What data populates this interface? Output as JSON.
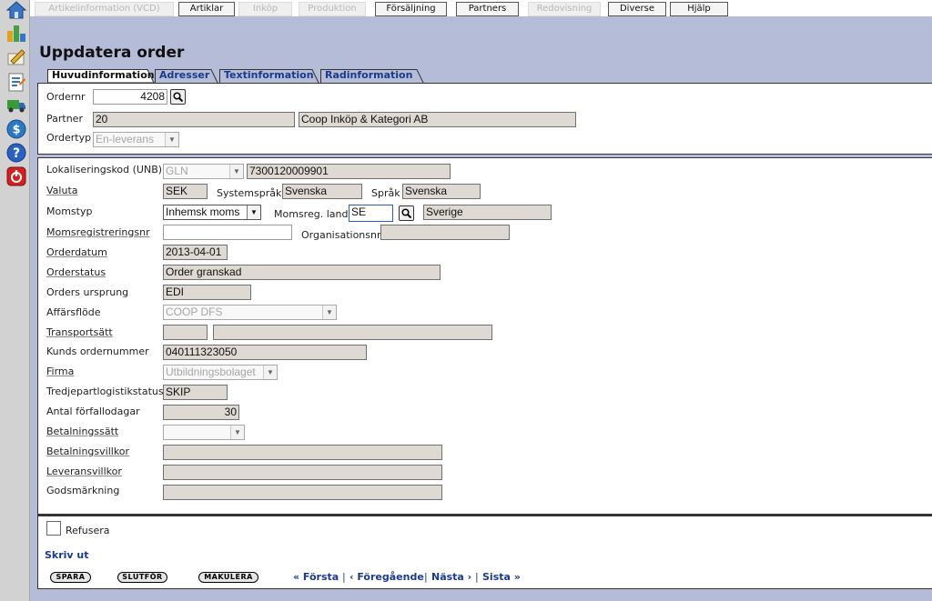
{
  "topmenu": {
    "items": [
      {
        "label": "Artikelinformation (VCD)",
        "enabled": false
      },
      {
        "label": "Artiklar",
        "enabled": true
      },
      {
        "label": "Inköp",
        "enabled": false
      },
      {
        "label": "Produktion",
        "enabled": false
      },
      {
        "label": "Försäljning",
        "enabled": true
      },
      {
        "label": "Partners",
        "enabled": true
      },
      {
        "label": "Redovisning",
        "enabled": false
      },
      {
        "label": "Diverse",
        "enabled": true
      },
      {
        "label": "Hjälp",
        "enabled": true
      }
    ]
  },
  "sidebar": {
    "icons": [
      "home-icon",
      "stats-icon",
      "edit-icon",
      "list-icon",
      "truck-icon",
      "money-icon",
      "help-icon",
      "power-icon"
    ]
  },
  "page": {
    "title": "Uppdatera order"
  },
  "tabs": [
    {
      "label": "Huvudinformation",
      "active": true
    },
    {
      "label": "Adresser",
      "active": false
    },
    {
      "label": "Textinformation",
      "active": false
    },
    {
      "label": "Radinformation",
      "active": false
    }
  ],
  "header": {
    "ordernr_label": "Ordernr",
    "ordernr_value": "4208",
    "partner_label": "Partner",
    "partner_code": "20",
    "partner_name": "Coop Inköp & Kategori AB",
    "ordertyp_label": "Ordertyp",
    "ordertyp_value": "En-leverans"
  },
  "details": {
    "lokaliseringskod_label": "Lokaliseringskod (UNB)",
    "lokaliseringskod_type": "GLN",
    "lokaliseringskod_value": "7300120009901",
    "valuta_label": "Valuta",
    "valuta_value": "SEK",
    "systemsprak_label": "Systemspråk",
    "systemsprak_value": "Svenska",
    "sprak_label": "Språk",
    "sprak_value": "Svenska",
    "momstyp_label": "Momstyp",
    "momstyp_value": "Inhemsk moms",
    "momsreg_land_label": "Momsreg. land",
    "momsreg_land_code": "SE",
    "momsreg_land_name": "Sverige",
    "momsregistreringsnr_label": "Momsregistreringsnr",
    "momsregistreringsnr_value": "",
    "organisationsnr_label": "Organisationsnr",
    "organisationsnr_value": "",
    "orderdatum_label": "Orderdatum",
    "orderdatum_value": "2013-04-01",
    "orderstatus_label": "Orderstatus",
    "orderstatus_value": "Order granskad",
    "orders_ursprung_label": "Orders ursprung",
    "orders_ursprung_value": "EDI",
    "affarsflode_label": "Affärsflöde",
    "affarsflode_value": "COOP DFS",
    "transportsatt_label": "Transportsätt",
    "transportsatt_code": "",
    "transportsatt_name": "",
    "kunds_ordernummer_label": "Kunds ordernummer",
    "kunds_ordernummer_value": "040111323050",
    "firma_label": "Firma",
    "firma_value": "Utbildningsbolaget",
    "tredjepart_label": "Tredjepartlogistikstatus",
    "tredjepart_value": "SKIP",
    "forfallodagar_label": "Antal förfallodagar",
    "forfallodagar_value": "30",
    "betalningssatt_label": "Betalningssätt",
    "betalningssatt_value": "",
    "betalningsvillkor_label": "Betalningsvillkor",
    "betalningsvillkor_value": "",
    "leveransvillkor_label": "Leveransvillkor",
    "leveransvillkor_value": "",
    "godsmarkning_label": "Godsmärkning",
    "godsmarkning_value": ""
  },
  "footer": {
    "refusera_label": "Refusera",
    "refusera_checked": false,
    "skriv_ut_label": "Skriv ut",
    "spara_label": "SPARA",
    "slutfor_label": "SLUTFÖR",
    "makulera_label": "MAKULERA",
    "forsta_label": "« Första",
    "foregaende_label": "‹ Föregående",
    "nasta_label": "Nästa ›",
    "sista_label": "Sista »",
    "separator": "|"
  },
  "colors": {
    "background": "#b4bcd8",
    "link": "#1a3a8a",
    "field_bg": "#dedad3"
  }
}
